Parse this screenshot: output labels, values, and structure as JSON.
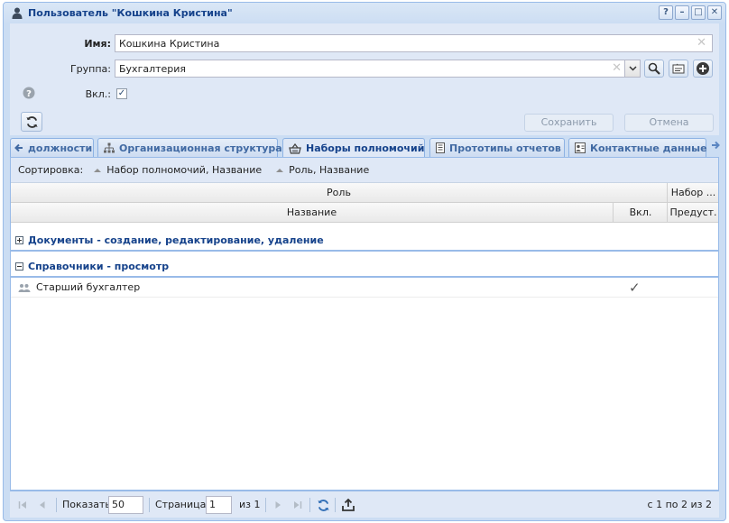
{
  "window": {
    "title": "Пользователь \"Кошкина Кристина\"",
    "tools": [
      "?",
      "–",
      "□",
      "✕"
    ]
  },
  "form": {
    "name_label": "Имя:",
    "name_value": "Кошкина Кристина",
    "group_label": "Группа:",
    "group_value": "Бухгалтерия",
    "enabled_label": "Вкл.:",
    "enabled_checked": true,
    "save_label": "Сохранить",
    "cancel_label": "Отмена"
  },
  "tabs": [
    {
      "label": "должности",
      "icon": "arrow-left-icon"
    },
    {
      "label": "Организационная структура",
      "icon": "org-structure-icon"
    },
    {
      "label": "Наборы полномочий",
      "icon": "basket-icon",
      "active": true
    },
    {
      "label": "Прототипы отчетов",
      "icon": "report-icon"
    },
    {
      "label": "Контактные данные",
      "icon": "contact-card-icon"
    }
  ],
  "sort": {
    "label": "Сортировка:",
    "items": [
      "Набор полномочий, Название",
      "Роль, Название"
    ]
  },
  "grid": {
    "header_top": {
      "role": "Роль",
      "set": "Набор ..."
    },
    "header_bottom": {
      "name": "Название",
      "enabled": "Вкл.",
      "predefined": "Предуст."
    },
    "groups": [
      {
        "label": "Документы - создание, редактирование, удаление",
        "expanded": false
      },
      {
        "label": "Справочники - просмотр",
        "expanded": true
      }
    ],
    "rows": [
      {
        "name": "Старший бухгалтер",
        "enabled": "✓",
        "predefined": ""
      }
    ]
  },
  "pager": {
    "show_label": "Показать",
    "page_size": "50",
    "page_label": "Страница",
    "page_value": "1",
    "of_label": "из 1",
    "range_text": "с 1 по 2 из 2"
  },
  "colors": {
    "accent": "#15428b",
    "border": "#99bbe8",
    "panel_bg": "#dfe8f6"
  }
}
